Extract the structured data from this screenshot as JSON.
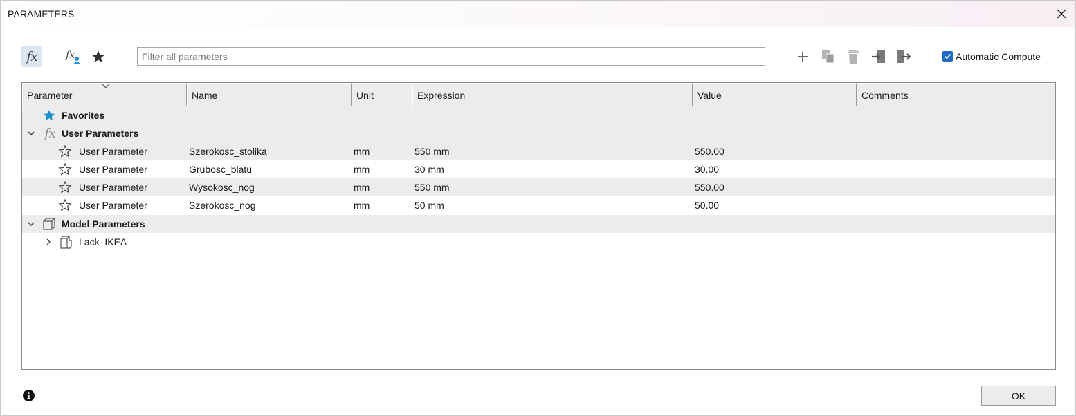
{
  "window": {
    "title": "PARAMETERS",
    "close_icon": "close-icon"
  },
  "toolbar": {
    "filter_placeholder": "Filter all parameters",
    "automatic_compute_label": "Automatic Compute",
    "automatic_compute_checked": true,
    "fx_label": "fx"
  },
  "table": {
    "columns": [
      "Parameter",
      "Name",
      "Unit",
      "Expression",
      "Value",
      "Comments"
    ],
    "favorites_label": "Favorites",
    "user_group_label": "User Parameters",
    "user_rows": [
      {
        "parameter": "User Parameter",
        "name": "Szerokosc_stolika",
        "unit": "mm",
        "expression": "550 mm",
        "value": "550.00",
        "comments": ""
      },
      {
        "parameter": "User Parameter",
        "name": "Grubosc_blatu",
        "unit": "mm",
        "expression": "30 mm",
        "value": "30.00",
        "comments": ""
      },
      {
        "parameter": "User Parameter",
        "name": "Wysokosc_nog",
        "unit": "mm",
        "expression": "550 mm",
        "value": "550.00",
        "comments": ""
      },
      {
        "parameter": "User Parameter",
        "name": "Szerokosc_nog",
        "unit": "mm",
        "expression": "50 mm",
        "value": "50.00",
        "comments": ""
      }
    ],
    "model_group_label": "Model Parameters",
    "model_component_label": "Lack_IKEA"
  },
  "footer": {
    "ok_label": "OK"
  },
  "colors": {
    "accent": "#1f6bc4",
    "star_favorite": "#1a8fd6",
    "fx_highlight": "#dce6f2"
  }
}
